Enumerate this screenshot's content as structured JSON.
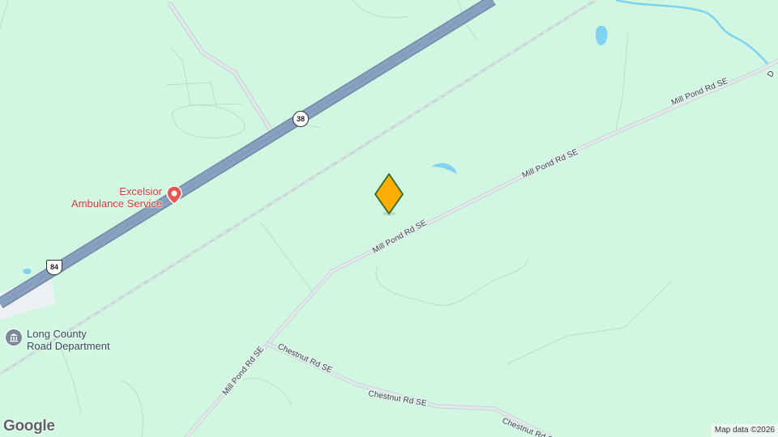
{
  "map": {
    "background_color": "#d1f7e2",
    "water_color": "#7fd3f0",
    "highway_color": "#8aa0bf",
    "road_color": "#dbe3e6"
  },
  "roads": {
    "mill_pond_1": "Mill Pond Rd SE",
    "mill_pond_2": "Mill Pond Rd SE",
    "mill_pond_3": "Mill Pond Rd SE",
    "mill_pond_4": "Mill Pond Rd SE",
    "chestnut_1": "Chestnut Rd SE",
    "chestnut_2": "Chestnut Rd SE",
    "chestnut_3": "Chestnut Rd SE",
    "edge_d": "D"
  },
  "shields": {
    "route_38": "38",
    "us_84": "84"
  },
  "pois": {
    "ambulance": {
      "line1": "Excelsior",
      "line2": "Ambulance Service",
      "icon": "hospital-pin-icon",
      "color": "#d33a3a"
    },
    "road_dept": {
      "line1": "Long County",
      "line2": "Road Department",
      "icon": "government-building-icon"
    }
  },
  "marker": {
    "icon": "location-marker-icon",
    "color": "#ffad00"
  },
  "footer": {
    "logo": "Google",
    "attribution": "Map data ©2026"
  }
}
